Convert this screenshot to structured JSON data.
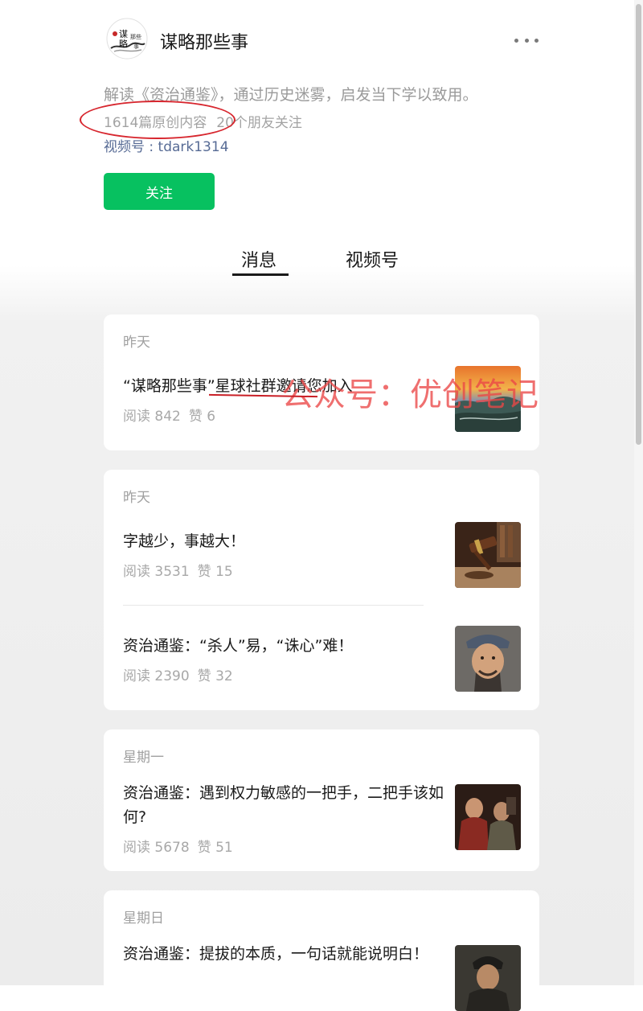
{
  "account": {
    "name": "谋略那些事",
    "logo_text": "谋略那些事",
    "description": "解读《资治通鉴》，通过历史迷雾，启发当下学以致用。",
    "original_count": "1614篇原创内容",
    "friends_following": "20个朋友关注",
    "channel": "视频号 : tdark1314",
    "follow_label": "关注"
  },
  "tabs": [
    {
      "label": "消息",
      "active": true
    },
    {
      "label": "视频号",
      "active": false
    }
  ],
  "feed": [
    {
      "day": "昨天",
      "articles": [
        {
          "title": "“谋略那些事”星球社群邀请您加入",
          "reads": "阅读 842",
          "likes": "赞 6",
          "thumb": "landscape"
        }
      ]
    },
    {
      "day": "昨天",
      "articles": [
        {
          "title": "字越少，事越大！",
          "reads": "阅读 3531",
          "likes": "赞 15",
          "thumb": "gavel"
        },
        {
          "title": "资治通鉴：“杀人”易，“诛心”难！",
          "reads": "阅读 2390",
          "likes": "赞 32",
          "thumb": "portrait"
        }
      ]
    },
    {
      "day": "星期一",
      "articles": [
        {
          "title": "资治通鉴：遇到权力敏感的一把手，二把手该如何?",
          "reads": "阅读 5678",
          "likes": "赞 51",
          "thumb": "drama"
        }
      ]
    },
    {
      "day": "星期日",
      "articles": [
        {
          "title": "资治通鉴：提拔的本质，一句话就能说明白！",
          "thumb": "portrait-dark"
        }
      ]
    }
  ],
  "watermark": "公众号：优创笔记",
  "colors": {
    "follow_green": "#07c160",
    "link_blue": "#576b95",
    "annotation_red": "#d7262e"
  }
}
